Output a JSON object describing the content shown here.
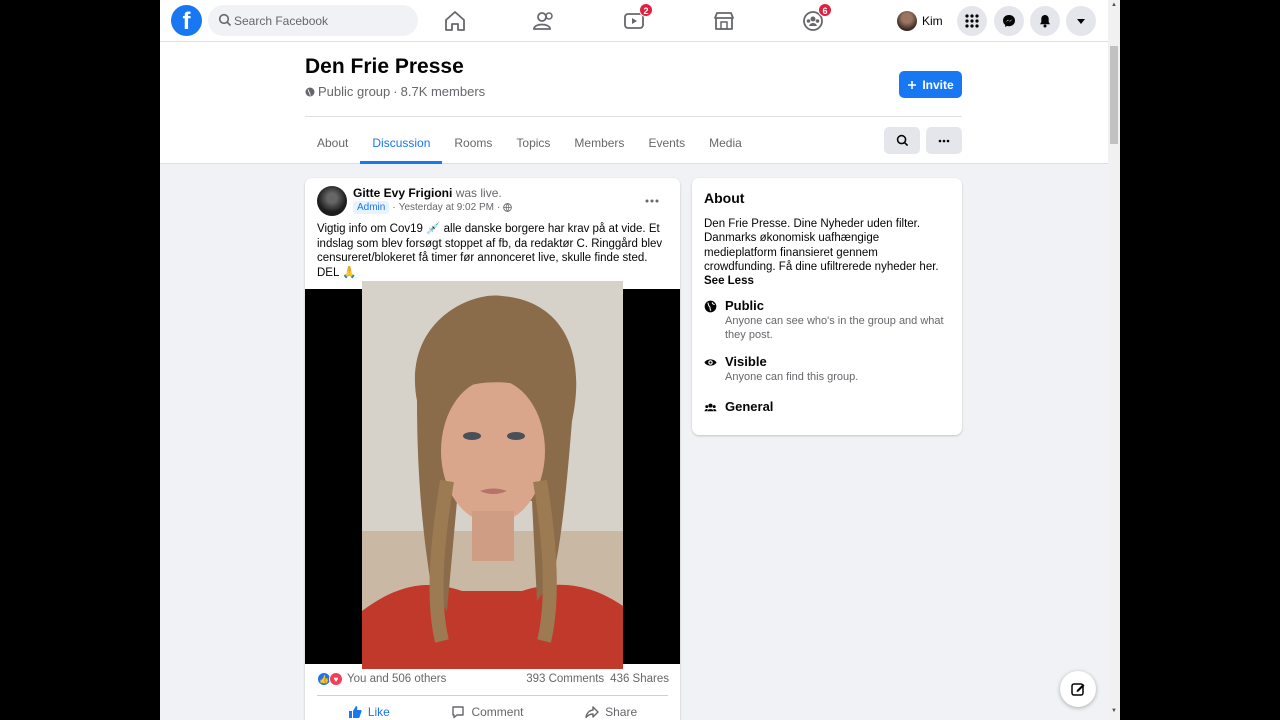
{
  "nav": {
    "search_placeholder": "Search Facebook",
    "watch_badge": "2",
    "groups_badge": "6",
    "profile_name": "Kim"
  },
  "group": {
    "name": "Den Frie Presse",
    "privacy": "Public group",
    "members": "8.7K members",
    "invite_label": "Invite",
    "tabs": [
      "About",
      "Discussion",
      "Rooms",
      "Topics",
      "Members",
      "Events",
      "Media"
    ],
    "active_tab": "Discussion"
  },
  "post": {
    "author": "Gitte Evy Frigioni",
    "status": "was live.",
    "role": "Admin",
    "time": "Yesterday at 9:02 PM",
    "text": "Vigtig info om Cov19 💉 alle danske borgere har krav på at vide. Et indslag som blev forsøgt stoppet af fb, da redaktør C. Ringgård blev censureret/blokeret få timer før annonceret live, skulle finde sted. DEL 🙏",
    "reactions_text": "You and 506 others",
    "comments": "393 Comments",
    "shares": "436 Shares",
    "like_label": "Like",
    "comment_label": "Comment",
    "share_label": "Share"
  },
  "about": {
    "title": "About",
    "description": "Den Frie Presse. Dine Nyheder uden filter. Danmarks økonomisk uafhængige medieplatform finansieret gennem crowdfunding. Få dine ufiltrerede nyheder her.",
    "see_less": "See Less",
    "public_title": "Public",
    "public_desc": "Anyone can see who's in the group and what they post.",
    "visible_title": "Visible",
    "visible_desc": "Anyone can find this group.",
    "general_title": "General"
  },
  "colors": {
    "brand": "#1877f2",
    "badge": "#e41e3f",
    "background": "#f0f2f5"
  }
}
